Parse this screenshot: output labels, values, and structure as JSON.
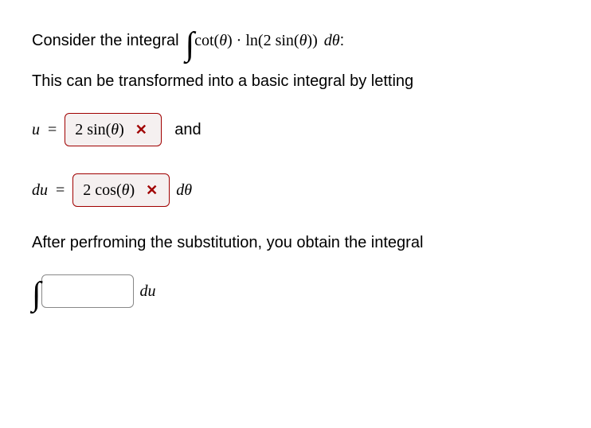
{
  "intro": {
    "prefix": "Consider the integral ",
    "integrand": "cot(θ) · ln(2 sin(θ)) ",
    "differential": "dθ",
    "colon": ":"
  },
  "transform_text": "This can be transformed into a basic integral by letting",
  "u_row": {
    "lhs_var": "u",
    "equals": " = ",
    "input_value": "2 sin(θ)",
    "and": "and"
  },
  "du_row": {
    "lhs_var": "du",
    "equals": " = ",
    "input_value": "2 cos(θ)",
    "differential": "dθ"
  },
  "after_text": "After perfroming the substitution, you obtain the integral",
  "result_row": {
    "input_value": "",
    "differential": "du"
  },
  "icons": {
    "wrong": "✕"
  }
}
